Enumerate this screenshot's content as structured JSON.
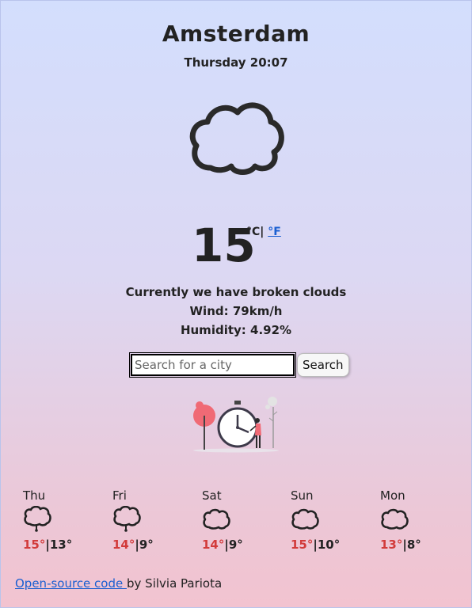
{
  "header": {
    "city": "Amsterdam",
    "datetime": "Thursday 20:07"
  },
  "current": {
    "icon": "cloud-icon",
    "temperature": "15",
    "unit_celsius": "°C|",
    "unit_fahrenheit": "°F",
    "description": "Currently we have broken clouds",
    "wind": "Wind: 79km/h",
    "humidity": "Humidity: 4.92%"
  },
  "search": {
    "placeholder": "Search for a city",
    "button_label": "Search"
  },
  "illustration": {
    "icon": "clock-illustration"
  },
  "forecast": [
    {
      "day": "Thu",
      "icon": "rain-cloud-icon",
      "max": "15°",
      "separator": "|",
      "min": "13°"
    },
    {
      "day": "Fri",
      "icon": "rain-cloud-icon",
      "max": "14°",
      "separator": "|",
      "min": "9°"
    },
    {
      "day": "Sat",
      "icon": "cloud-icon",
      "max": "14°",
      "separator": "|",
      "min": "9°"
    },
    {
      "day": "Sun",
      "icon": "cloud-icon",
      "max": "15°",
      "separator": "|",
      "min": "10°"
    },
    {
      "day": "Mon",
      "icon": "cloud-icon",
      "max": "13°",
      "separator": "|",
      "min": "8°"
    }
  ],
  "footer": {
    "link_text": "Open-source code ",
    "text": "by Silvia Pariota"
  },
  "colors": {
    "max_temp": "#d23b3b",
    "link": "#1a5fd1"
  }
}
